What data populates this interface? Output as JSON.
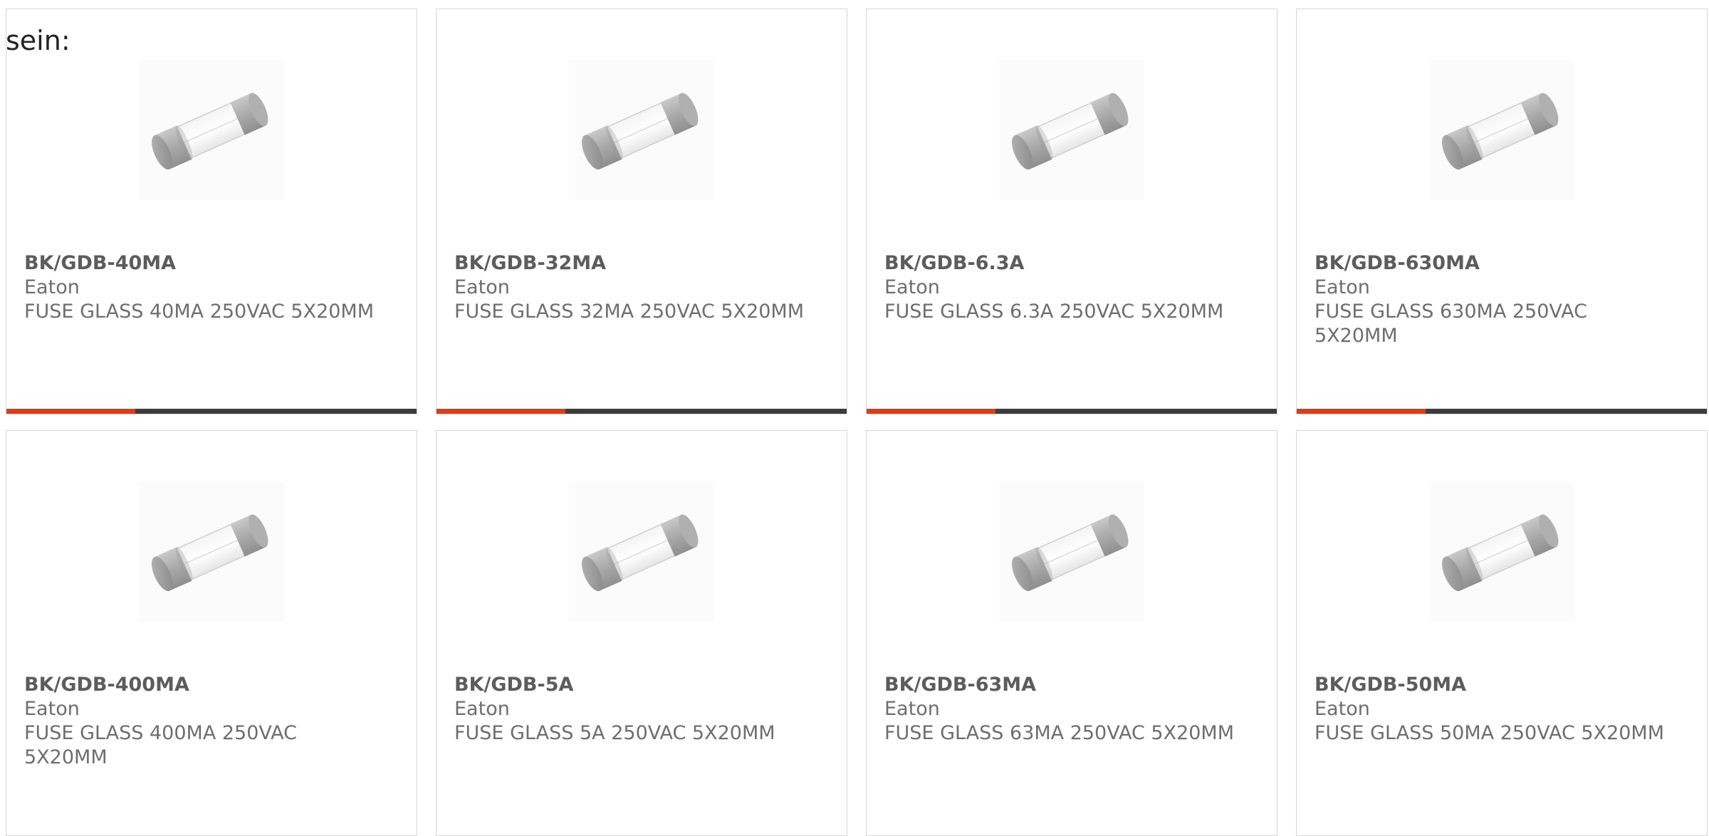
{
  "intro_text": "sein:",
  "colors": {
    "accent": "#e23a14",
    "bar": "#3c3c3c",
    "text": "#6e6e6e"
  },
  "products": [
    {
      "part_number": "BK/GDB-40MA",
      "manufacturer": "Eaton",
      "description": "FUSE GLASS 40MA 250VAC 5X20MM",
      "image_icon": "glass-fuse-icon"
    },
    {
      "part_number": "BK/GDB-32MA",
      "manufacturer": "Eaton",
      "description": "FUSE GLASS 32MA 250VAC 5X20MM",
      "image_icon": "glass-fuse-icon"
    },
    {
      "part_number": "BK/GDB-6.3A",
      "manufacturer": "Eaton",
      "description": "FUSE GLASS 6.3A 250VAC 5X20MM",
      "image_icon": "glass-fuse-icon"
    },
    {
      "part_number": "BK/GDB-630MA",
      "manufacturer": "Eaton",
      "description": "FUSE GLASS 630MA 250VAC 5X20MM",
      "image_icon": "glass-fuse-icon"
    },
    {
      "part_number": "BK/GDB-400MA",
      "manufacturer": "Eaton",
      "description": "FUSE GLASS 400MA 250VAC 5X20MM",
      "image_icon": "glass-fuse-icon"
    },
    {
      "part_number": "BK/GDB-5A",
      "manufacturer": "Eaton",
      "description": "FUSE GLASS 5A 250VAC 5X20MM",
      "image_icon": "glass-fuse-icon"
    },
    {
      "part_number": "BK/GDB-63MA",
      "manufacturer": "Eaton",
      "description": "FUSE GLASS 63MA 250VAC 5X20MM",
      "image_icon": "glass-fuse-icon"
    },
    {
      "part_number": "BK/GDB-50MA",
      "manufacturer": "Eaton",
      "description": "FUSE GLASS 50MA 250VAC 5X20MM",
      "image_icon": "glass-fuse-icon"
    }
  ]
}
